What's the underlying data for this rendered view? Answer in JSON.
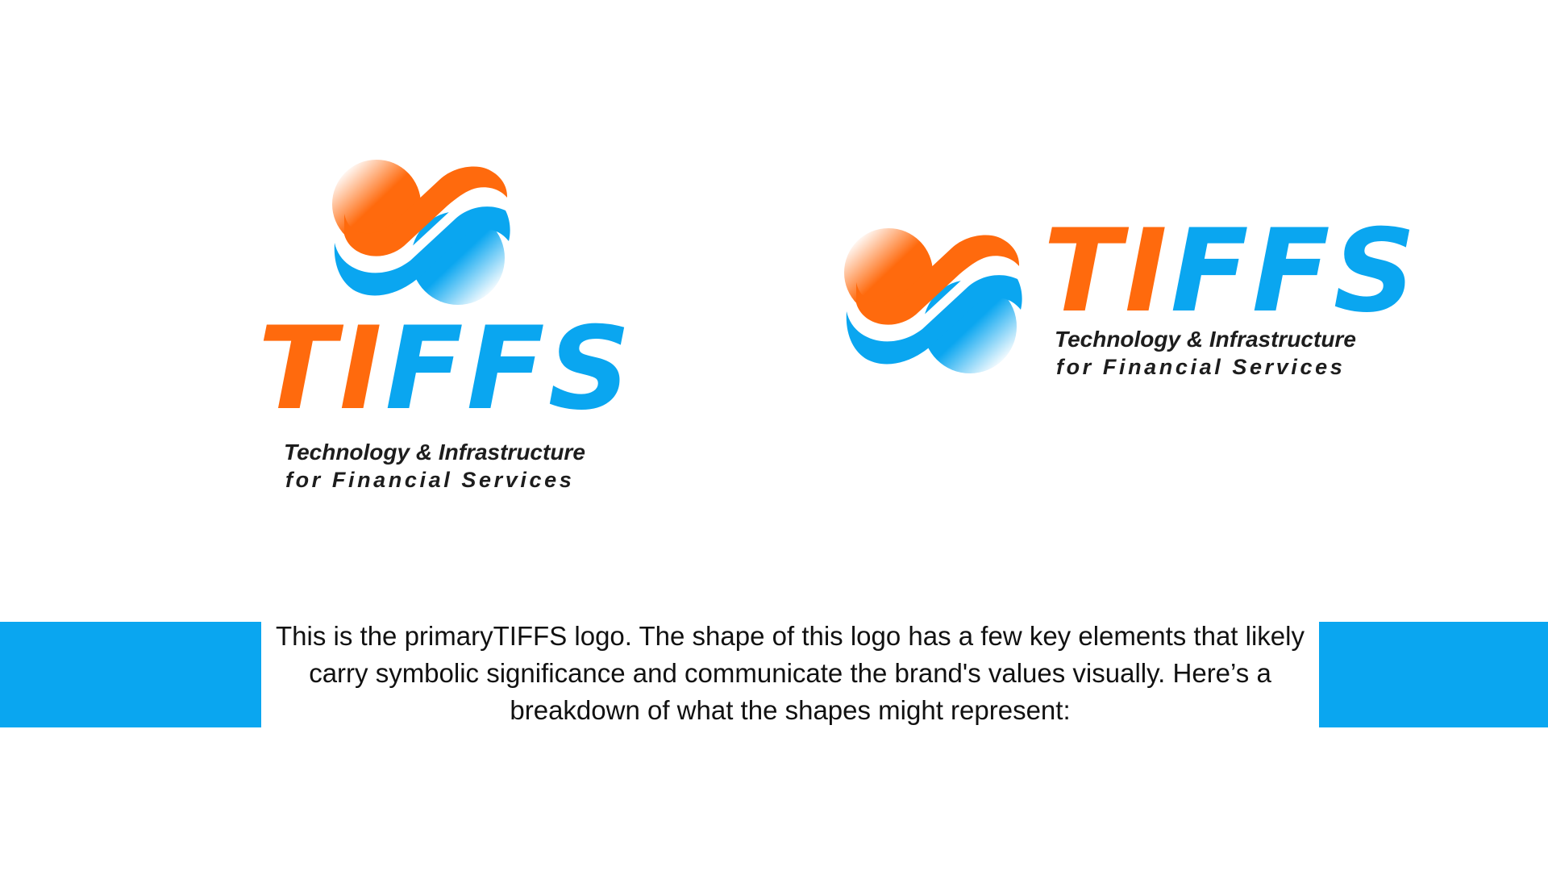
{
  "brand": {
    "name_part_orange": "TI",
    "name_part_blue": "FFS",
    "tagline_line1": "Technology & Infrastructure",
    "tagline_line2": "for Financial Services",
    "colors": {
      "orange": "#ff6a0d",
      "blue": "#0aa6f0",
      "text": "#1d1d1d"
    },
    "mark_icon": "swoosh-s-mark-icon"
  },
  "caption": {
    "text": "This is the primaryTIFFS logo. The shape of this logo has a few key elements that likely carry symbolic significance and communicate the brand's values visually. Here’s a breakdown of what the shapes might represent:"
  }
}
